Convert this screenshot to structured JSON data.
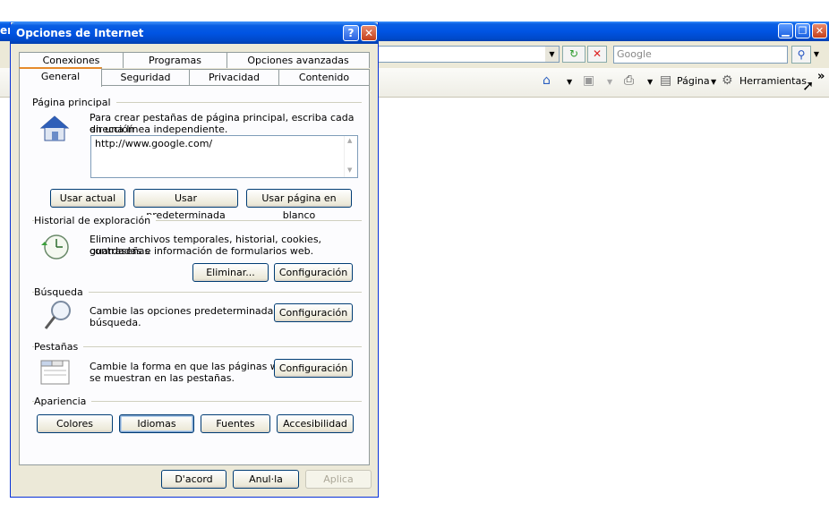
{
  "background_browser": {
    "title_fragment": "er",
    "search_placeholder": "Google",
    "commands": {
      "page_label": "Página",
      "tools_label": "Herramientas",
      "more": "»"
    }
  },
  "dialog": {
    "title": "Opciones de Internet",
    "help_button": "?",
    "close_button": "✕",
    "tabs_back": [
      "Conexiones",
      "Programas",
      "Opciones avanzadas"
    ],
    "tabs_front": [
      "General",
      "Seguridad",
      "Privacidad",
      "Contenido"
    ],
    "active_tab": "General",
    "home": {
      "group_title": "Página principal",
      "description_line1": "Para crear pestañas de página principal, escriba cada dirección",
      "description_line2": "en una línea independiente.",
      "url_value": "http://www.google.com/",
      "btn_current": "Usar actual",
      "btn_default": "Usar predeterminada",
      "btn_blank": "Usar página en blanco"
    },
    "history": {
      "group_title": "Historial de exploración",
      "description_line1": "Elimine archivos temporales, historial, cookies, contraseñas",
      "description_line2": "guardadas e información de formularios web.",
      "btn_delete": "Eliminar...",
      "btn_settings": "Configuración"
    },
    "search": {
      "group_title": "Búsqueda",
      "description_line1": "Cambie las opciones predeterminadas de",
      "description_line2": "búsqueda.",
      "btn_settings": "Configuración"
    },
    "tabs_section": {
      "group_title": "Pestañas",
      "description_line1": "Cambie la forma en que las páginas web",
      "description_line2": "se muestran en las pestañas.",
      "btn_settings": "Configuración"
    },
    "appearance": {
      "group_title": "Apariencia",
      "btn_colors": "Colores",
      "btn_languages": "Idiomas",
      "btn_fonts": "Fuentes",
      "btn_accessibility": "Accesibilidad"
    },
    "footer": {
      "btn_ok": "D'acord",
      "btn_cancel": "Anul·la",
      "btn_apply": "Aplica"
    }
  }
}
